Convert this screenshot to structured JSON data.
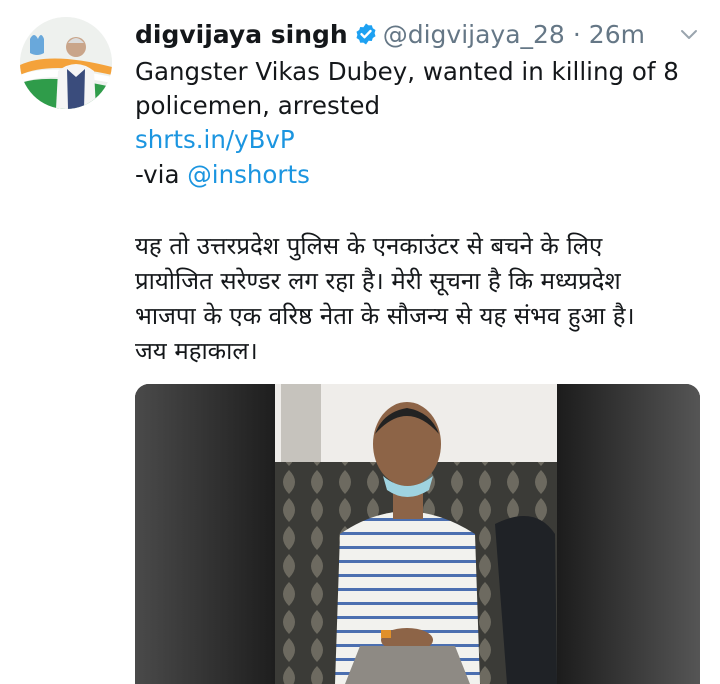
{
  "tweet": {
    "display_name": "digvijaya singh",
    "handle": "@digvijaya_28",
    "separator": "·",
    "time": "26m",
    "text_en_line1": "Gangster Vikas Dubey, wanted in killing of 8",
    "text_en_line2": "policemen, arrested",
    "link": "shrts.in/yBvP",
    "via_prefix": "-via ",
    "via_handle": "@inshorts",
    "text_hi_lines": [
      "यह तो उत्तरप्रदेश पुलिस के एनकाउंटर से बचने के लिए",
      "प्रायोजित सरेण्डर लग रहा है। मेरी सूचना है कि मध्यप्रदेश",
      "भाजपा के एक वरिष्ठ नेता के सौजन्य से यह संभव हुआ है।",
      "जय महाकाल।"
    ]
  },
  "icons": {
    "avatar": "profile-photo",
    "verified": "verified-badge-icon",
    "menu": "chevron-down-icon"
  },
  "colors": {
    "link": "#1b95e0",
    "muted": "#657786",
    "verified": "#1da1f2",
    "text": "#14171a"
  }
}
